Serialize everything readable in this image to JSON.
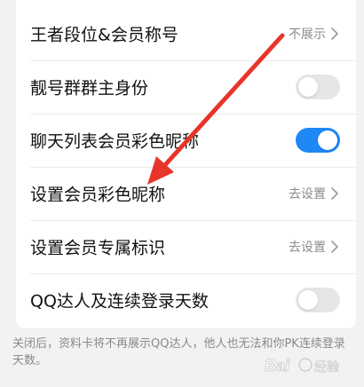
{
  "settings": {
    "rows": [
      {
        "label": "王者段位&会员称号",
        "value": "不展示",
        "type": "nav"
      },
      {
        "label": "靓号群群主身份",
        "type": "toggle",
        "on": false
      },
      {
        "label": "聊天列表会员彩色昵称",
        "type": "toggle",
        "on": true
      },
      {
        "label": "设置会员彩色昵称",
        "value": "去设置",
        "type": "nav"
      },
      {
        "label": "设置会员专属标识",
        "value": "去设置",
        "type": "nav"
      },
      {
        "label": "QQ达人及连续登录天数",
        "type": "toggle",
        "on": false
      }
    ]
  },
  "footer": {
    "note": "关闭后，资料卡将不再展示QQ达人，他人也无法和你PK连续登录天数。"
  },
  "colors": {
    "toggle_on": "#1e88f5",
    "toggle_off": "#e6e6e6",
    "annotation_arrow": "#e8352b"
  },
  "icons": {
    "chevron": "chevron-right-icon",
    "annotation": "red-arrow-icon",
    "watermark": "baidu-watermark-logo"
  }
}
